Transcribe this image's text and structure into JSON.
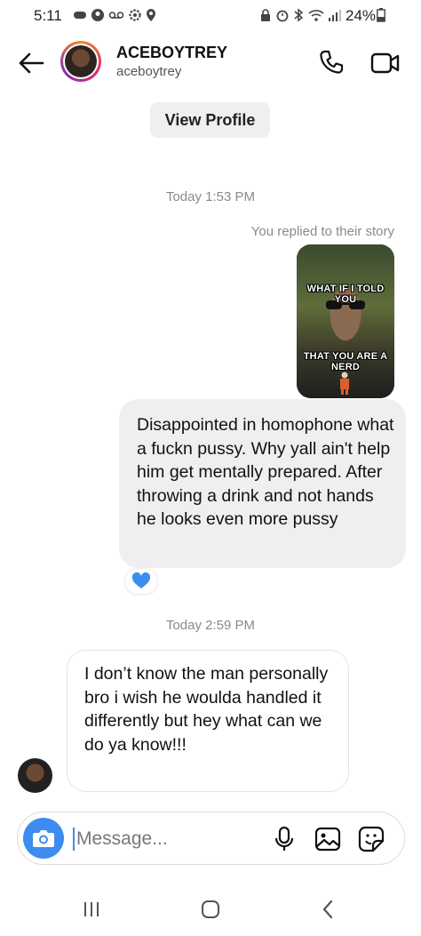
{
  "status_bar": {
    "time": "5:11",
    "battery": "24%"
  },
  "header": {
    "display_name": "ACEBOYTREY",
    "username": "aceboytrey"
  },
  "view_profile_label": "View Profile",
  "conversation": {
    "timestamp_1": "Today 1:53 PM",
    "story_reply_note": "You replied to their story",
    "story_caption_top": "WHAT IF I TOLD YOU",
    "story_caption_bottom": "THAT YOU ARE A NERD",
    "outgoing_message": "Disappointed in homophone what a fuckn pussy. Why yall ain't help him get mentally prepared. After throwing a drink and not hands he looks even more pussy",
    "reaction": "💙",
    "timestamp_2": "Today 2:59 PM",
    "incoming_message": "I don’t know the man personally bro i wish he woulda handled it differently but hey what can we do ya know!!!"
  },
  "composer": {
    "placeholder": "Message..."
  },
  "colors": {
    "accent": "#3d8cf0",
    "bubble_out": "#efefef",
    "muted_text": "#8a8a8a"
  },
  "icons": [
    "back-arrow-icon",
    "phone-icon",
    "video-call-icon",
    "camera-icon",
    "microphone-icon",
    "gallery-icon",
    "sticker-icon",
    "recent-apps-icon",
    "home-icon",
    "nav-back-icon"
  ]
}
